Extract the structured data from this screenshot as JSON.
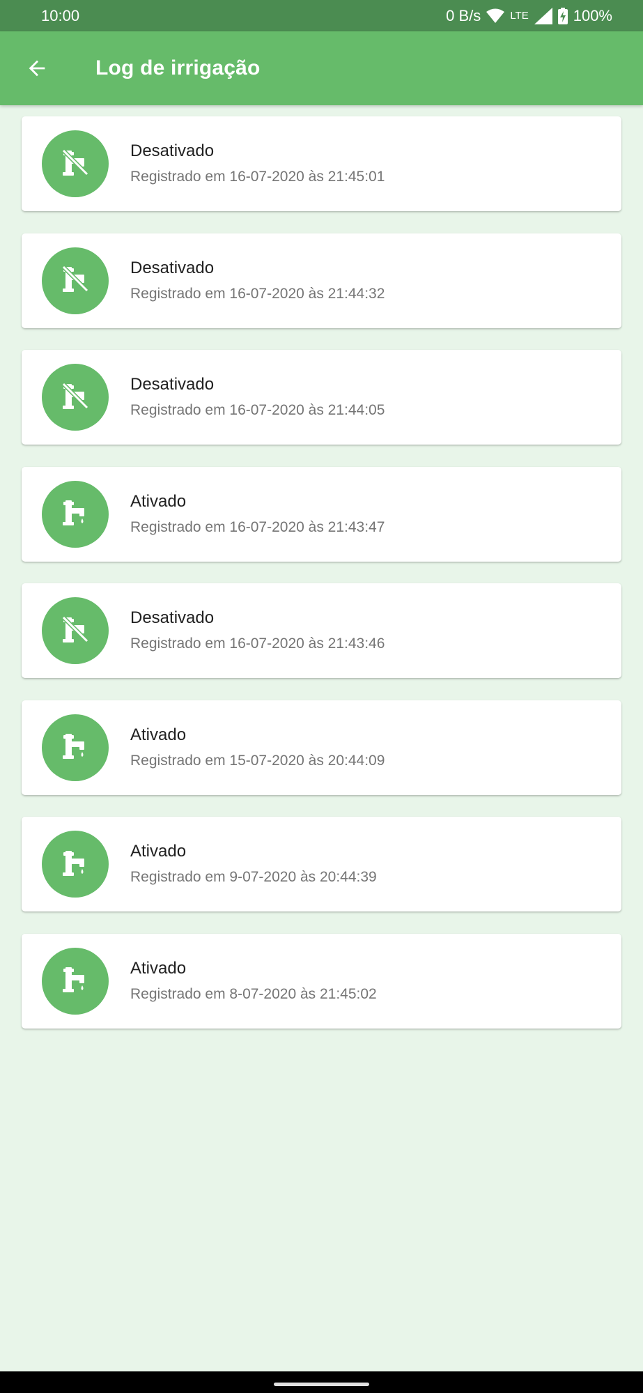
{
  "status_bar": {
    "time": "10:00",
    "net_speed": "0 B/s",
    "network_type": "LTE",
    "battery": "100%",
    "icons": [
      "wifi-icon",
      "signal-icon",
      "battery-charging-icon"
    ]
  },
  "app_bar": {
    "title": "Log de irrigação",
    "back_icon": "arrow-back-icon"
  },
  "colors": {
    "status_bar": "#4b8c51",
    "app_bar": "#66bb6a",
    "avatar": "#66bb6a",
    "background": "#e8f5e9"
  },
  "log": [
    {
      "state": "Desativado",
      "icon": "faucet-off-icon",
      "registered": "Registrado em 16-07-2020 às 21:45:01"
    },
    {
      "state": "Desativado",
      "icon": "faucet-off-icon",
      "registered": "Registrado em 16-07-2020 às 21:44:32"
    },
    {
      "state": "Desativado",
      "icon": "faucet-off-icon",
      "registered": "Registrado em 16-07-2020 às 21:44:05"
    },
    {
      "state": "Ativado",
      "icon": "faucet-on-icon",
      "registered": "Registrado em 16-07-2020 às 21:43:47"
    },
    {
      "state": "Desativado",
      "icon": "faucet-off-icon",
      "registered": "Registrado em 16-07-2020 às 21:43:46"
    },
    {
      "state": "Ativado",
      "icon": "faucet-on-icon",
      "registered": "Registrado em 15-07-2020 às 20:44:09"
    },
    {
      "state": "Ativado",
      "icon": "faucet-on-icon",
      "registered": "Registrado em 9-07-2020 às 20:44:39"
    },
    {
      "state": "Ativado",
      "icon": "faucet-on-icon",
      "registered": "Registrado em 8-07-2020 às 21:45:02"
    }
  ]
}
